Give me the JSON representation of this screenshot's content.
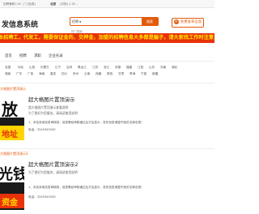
{
  "topbar": {
    "left": "招聘兼职2.0F...门 [免费]",
    "mid": "北京",
    "right": "[切换] 2.0F..."
  },
  "header": {
    "logo_text": "发信息系统",
    "search": {
      "category": "招聘",
      "placeholder": "",
      "button_label": "搜索"
    },
    "hot_prefix": "热门搜索：",
    "hot_value": "",
    "post_button_label": "免费发布信息"
  },
  "banner": {
    "text": "本招聘工，代发工，需要保证金的，交押金，加盟的招聘信息大多都是骗子，请大家找工作时注意，不"
  },
  "nav": {
    "items": [
      "首页",
      "招聘",
      "求职",
      "企业名录"
    ]
  },
  "regions": {
    "row1": [
      "全国",
      "河北",
      "山西",
      "内蒙古",
      "辽宁",
      "吉林",
      "黑龙江",
      "江苏",
      "浙江",
      "安徽",
      "福建",
      "江西",
      "山东",
      "河南",
      "湖北"
    ],
    "row2": [
      "湖南",
      "广东",
      "广西",
      "海南",
      "重庆",
      "四川",
      "贵州",
      "云南",
      "西藏",
      "陕西",
      "甘肃",
      "青海",
      "宁夏",
      "新疆"
    ]
  },
  "crumb": "大格图片置顶演示",
  "listings": [
    {
      "label": "大格图片置顶演示",
      "title": "超大格图片置顶演示",
      "sub1": "超大格图片置顶演示查看说明",
      "sub2": "为了更好为您服务，请阅读使用说明",
      "desc": "1、本站采用信息审核制，信息需经审核通过后才会显示，发布信息请遵守相关法律法规！",
      "phone_label": "电话：",
      "phone": "3245345345",
      "thumb_text1": "放",
      "thumb_text2": "地址"
    },
    {
      "label": "大格图片置顶演示2",
      "title": "超大格图片置顶演示2",
      "sub1": "为了更好为您服务，请阅读使用说明",
      "sub2": "",
      "desc": "1、本站采用信息审核制，信息需经审核通过后才会显示，发布信息请遵守相关法律法规！",
      "phone_label": "电话：",
      "phone": "3245345345",
      "thumb_text1": "光钱",
      "thumb_text2": "资金"
    }
  ],
  "colors": {
    "accent": "#e35a0a",
    "banner_bg": "#e8320a",
    "banner_text": "#ffe600"
  }
}
